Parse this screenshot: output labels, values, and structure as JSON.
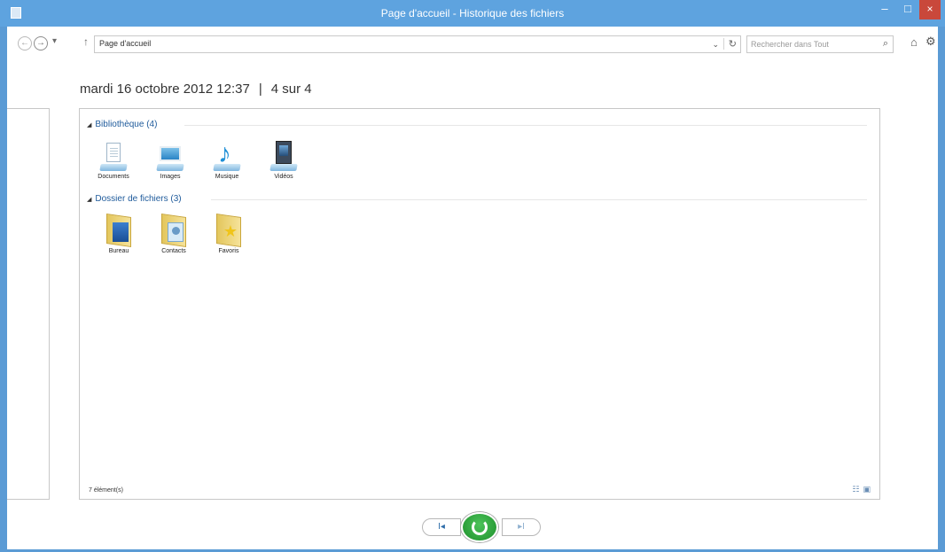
{
  "window": {
    "title": "Page d'accueil - Historique des fichiers",
    "buttons": {
      "minimize": "–",
      "maximize": "□",
      "close": "×"
    }
  },
  "navbar": {
    "back": "←",
    "forward": "→",
    "dropdown": "▾",
    "up": "↑",
    "address": "Page d'accueil",
    "address_dropdown": "⌄",
    "refresh": "↻",
    "search_placeholder": "Rechercher dans Tout",
    "search_icon": "⌕",
    "home_icon": "⌂",
    "settings_icon": "⚙"
  },
  "snapshot": {
    "date": "mardi 16 octobre 2012 12:37",
    "separator": "|",
    "position": "4 sur 4"
  },
  "groups": [
    {
      "title": "Bibliothèque (4)",
      "items": [
        {
          "label": "Documents",
          "icon": "documents-library-icon"
        },
        {
          "label": "Images",
          "icon": "pictures-library-icon"
        },
        {
          "label": "Musique",
          "icon": "music-library-icon"
        },
        {
          "label": "Vidéos",
          "icon": "videos-library-icon"
        }
      ]
    },
    {
      "title": "Dossier de fichiers (3)",
      "items": [
        {
          "label": "Bureau",
          "icon": "desktop-folder-icon"
        },
        {
          "label": "Contacts",
          "icon": "contacts-folder-icon"
        },
        {
          "label": "Favoris",
          "icon": "favorites-folder-icon"
        }
      ]
    }
  ],
  "status": {
    "count": "7 élément(s)"
  },
  "view_icons": {
    "details": "☷",
    "large": "▣"
  },
  "playback": {
    "previous": "I◂",
    "next": "▸I"
  },
  "colors": {
    "titlebar": "#5ea3df",
    "close": "#c9483b",
    "restore": "#2ea43c",
    "link": "#1e5a9b"
  }
}
